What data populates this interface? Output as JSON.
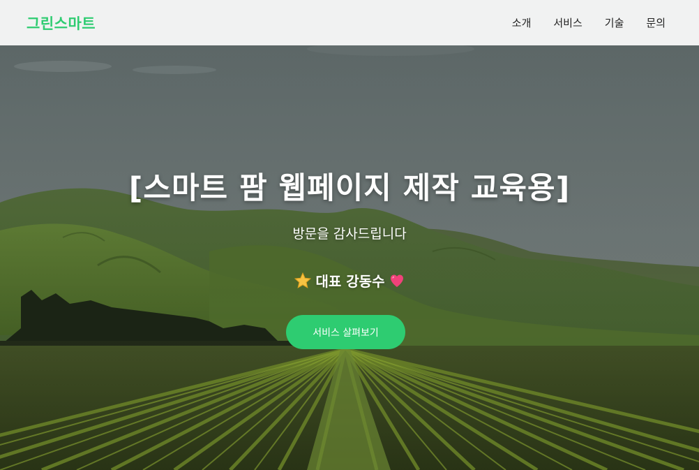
{
  "navbar": {
    "logo": "그린스마트",
    "links": [
      "소개",
      "서비스",
      "기술",
      "문의"
    ]
  },
  "hero": {
    "title": "[스마트 팜 웹페이지 제작 교육용]",
    "subtitle": "방문을 감사드립니다",
    "ceo_label": "대표 강동수",
    "ceo_prefix_icon": "star-icon",
    "ceo_suffix_icon": "heart-icon",
    "cta_label": "서비스 살펴보기"
  },
  "colors": {
    "accent": "#2ecc71",
    "navbar_bg": "#f1f2f2",
    "nav_text": "#222222",
    "hero_text": "#ffffff"
  }
}
